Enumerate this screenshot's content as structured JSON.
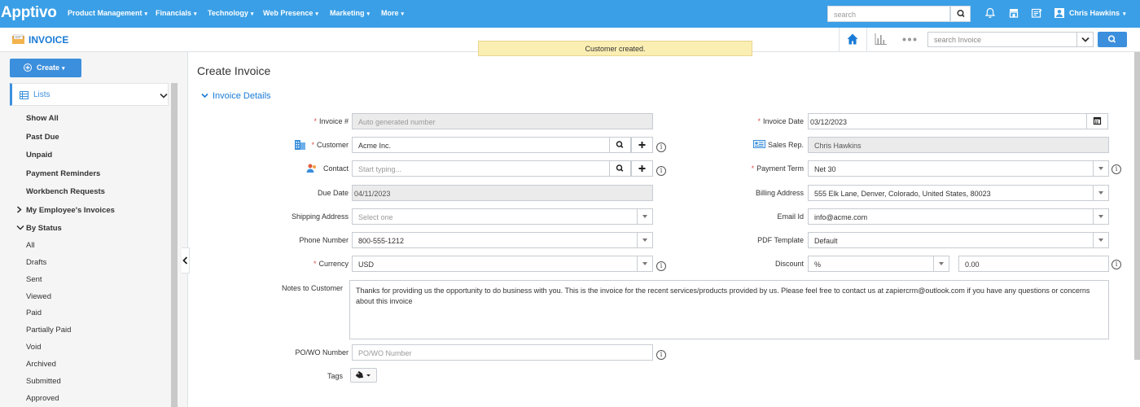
{
  "topbar": {
    "logo": "Apptivo",
    "nav": [
      "Product Management",
      "Financials",
      "Technology",
      "Web Presence",
      "Marketing",
      "More"
    ],
    "search_placeholder": "search",
    "user_name": "Chris Hawkins"
  },
  "subbar": {
    "app_title": "INVOICE",
    "notice": "Customer created.",
    "search_placeholder": "search Invoice"
  },
  "sidebar": {
    "create_label": "Create",
    "lists_label": "Lists",
    "items": [
      {
        "label": "Show All",
        "bold": true
      },
      {
        "label": "Past Due",
        "bold": true
      },
      {
        "label": "Unpaid",
        "bold": true
      },
      {
        "label": "Payment Reminders",
        "bold": true
      },
      {
        "label": "Workbench Requests",
        "bold": true
      },
      {
        "label": "My Employee's Invoices",
        "bold": true
      },
      {
        "label": "By Status",
        "bold": true
      },
      {
        "label": "All",
        "bold": false
      },
      {
        "label": "Drafts",
        "bold": false
      },
      {
        "label": "Sent",
        "bold": false
      },
      {
        "label": "Viewed",
        "bold": false
      },
      {
        "label": "Paid",
        "bold": false
      },
      {
        "label": "Partially Paid",
        "bold": false
      },
      {
        "label": "Void",
        "bold": false
      },
      {
        "label": "Archived",
        "bold": false
      },
      {
        "label": "Submitted",
        "bold": false
      },
      {
        "label": "Approved",
        "bold": false
      }
    ]
  },
  "form": {
    "page_title": "Create Invoice",
    "section_title": "Invoice Details",
    "invoice_no": {
      "label": "Invoice #",
      "placeholder": "Auto generated number"
    },
    "customer": {
      "label": "Customer",
      "value": "Acme Inc."
    },
    "contact": {
      "label": "Contact",
      "placeholder": "Start typing..."
    },
    "due_date": {
      "label": "Due Date",
      "value": "04/11/2023"
    },
    "shipping_address": {
      "label": "Shipping Address",
      "placeholder": "Select one"
    },
    "phone": {
      "label": "Phone Number",
      "value": "800-555-1212"
    },
    "currency": {
      "label": "Currency",
      "value": "USD"
    },
    "invoice_date": {
      "label": "Invoice Date",
      "value": "03/12/2023"
    },
    "sales_rep": {
      "label": "Sales Rep.",
      "value": "Chris Hawkins"
    },
    "payment_term": {
      "label": "Payment Term",
      "value": "Net 30"
    },
    "billing_address": {
      "label": "Billing Address",
      "value": "555 Elk Lane, Denver, Colorado, United States, 80023"
    },
    "email": {
      "label": "Email Id",
      "value": "info@acme.com"
    },
    "pdf_template": {
      "label": "PDF Template",
      "value": "Default"
    },
    "discount": {
      "label": "Discount",
      "type_value": "%",
      "amount": "0.00"
    },
    "notes": {
      "label": "Notes to Customer",
      "value": "Thanks for providing us the opportunity to do business with you. This is the invoice for the recent services/products provided by us. Please feel free to contact us at zapiercrm@outlook.com if you have any questions or concerns about this invoice"
    },
    "po_number": {
      "label": "PO/WO Number",
      "placeholder": "PO/WO Number"
    },
    "tags": {
      "label": "Tags"
    }
  }
}
